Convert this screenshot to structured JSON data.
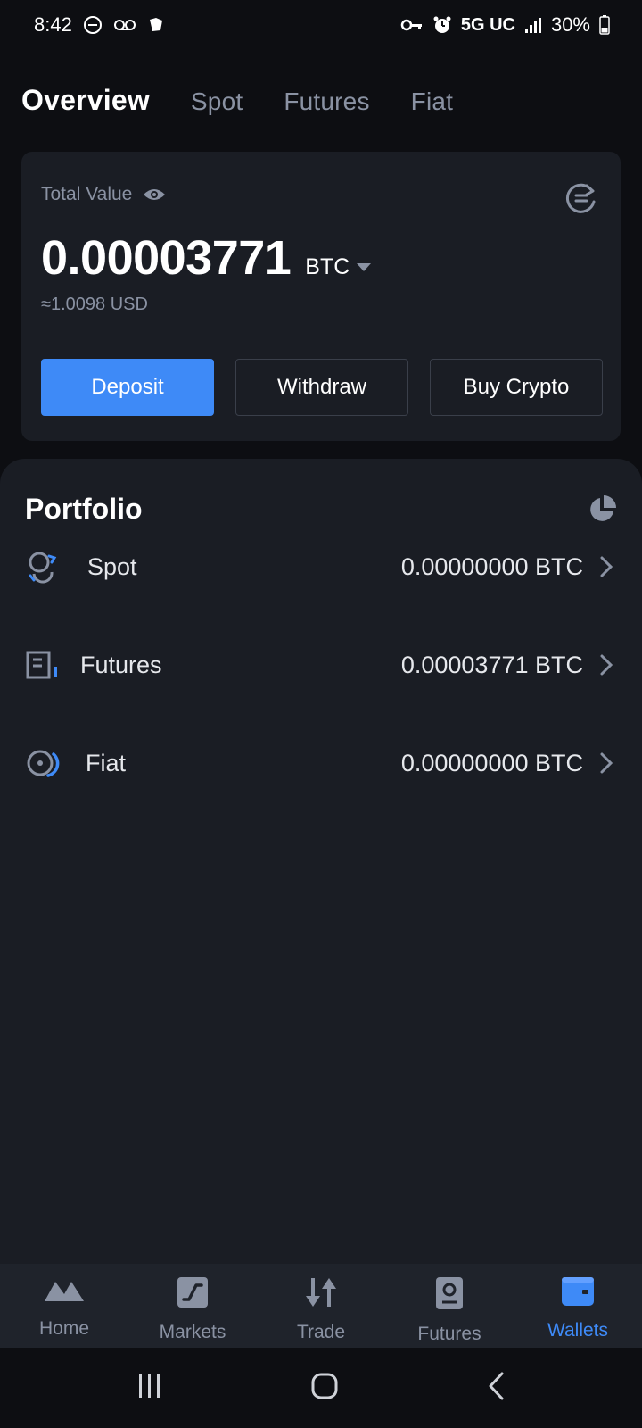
{
  "status_bar": {
    "time": "8:42",
    "network": "5G UC",
    "battery": "30%"
  },
  "tabs": [
    {
      "label": "Overview",
      "active": true
    },
    {
      "label": "Spot",
      "active": false
    },
    {
      "label": "Futures",
      "active": false
    },
    {
      "label": "Fiat",
      "active": false
    }
  ],
  "overview": {
    "total_label": "Total Value",
    "balance": "0.00003771",
    "unit": "BTC",
    "approx_usd": "≈1.0098 USD",
    "buttons": {
      "deposit": "Deposit",
      "withdraw": "Withdraw",
      "buy": "Buy Crypto"
    }
  },
  "portfolio": {
    "title": "Portfolio",
    "items": [
      {
        "label": "Spot",
        "value": "0.00000000 BTC"
      },
      {
        "label": "Futures",
        "value": "0.00003771 BTC"
      },
      {
        "label": "Fiat",
        "value": "0.00000000 BTC"
      }
    ]
  },
  "bottom_nav": [
    {
      "label": "Home",
      "icon": "home-icon",
      "active": false
    },
    {
      "label": "Markets",
      "icon": "markets-icon",
      "active": false
    },
    {
      "label": "Trade",
      "icon": "trade-icon",
      "active": false
    },
    {
      "label": "Futures",
      "icon": "futures-icon",
      "active": false
    },
    {
      "label": "Wallets",
      "icon": "wallet-icon",
      "active": true
    }
  ],
  "colors": {
    "accent": "#3e8af7",
    "background": "#0d0e12",
    "card": "#1a1d24",
    "muted_text": "#8a92a3"
  }
}
